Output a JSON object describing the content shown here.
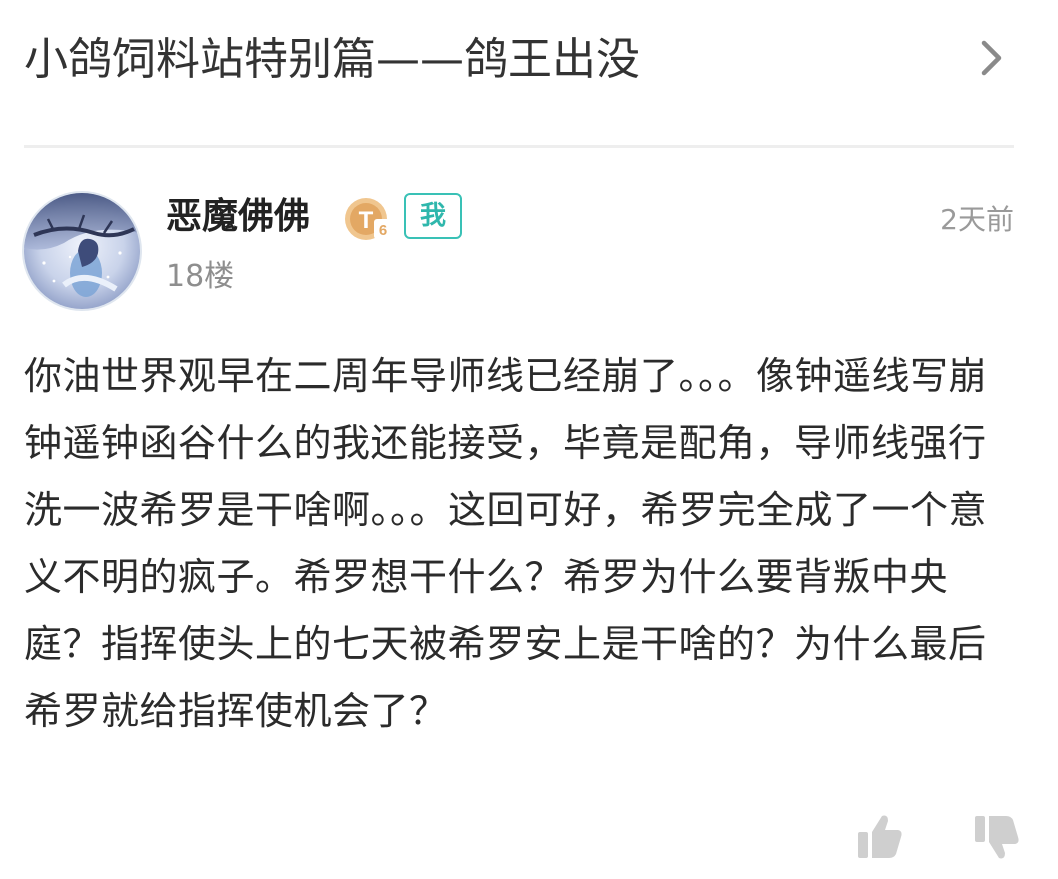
{
  "header": {
    "title": "小鸽饲料站特别篇——鸽王出没",
    "chevron_icon": "chevron-right-icon"
  },
  "post": {
    "username": "恶魔佛佛",
    "level_badge_icon": "level-badge-icon",
    "level_letter": "T",
    "level_number": "6",
    "me_badge": "我",
    "timestamp": "2天前",
    "floor": "18楼",
    "content": "你油世界观早在二周年导师线已经崩了。。。像钟遥线写崩钟遥钟函谷什么的我还能接受，毕竟是配角，导师线强行洗一波希罗是干啥啊。。。这回可好，希罗完全成了一个意义不明的疯子。希罗想干什么？希罗为什么要背叛中央庭？指挥使头上的七天被希罗安上是干啥的？为什么最后希罗就给指挥使机会了？"
  },
  "actions": {
    "like_icon": "thumbs-up-icon",
    "dislike_icon": "thumbs-down-icon"
  },
  "colors": {
    "accent": "#39c1b6",
    "badge_gold": "#e8b777",
    "muted_text": "#9a9a9a",
    "divider": "#eeeeee"
  }
}
